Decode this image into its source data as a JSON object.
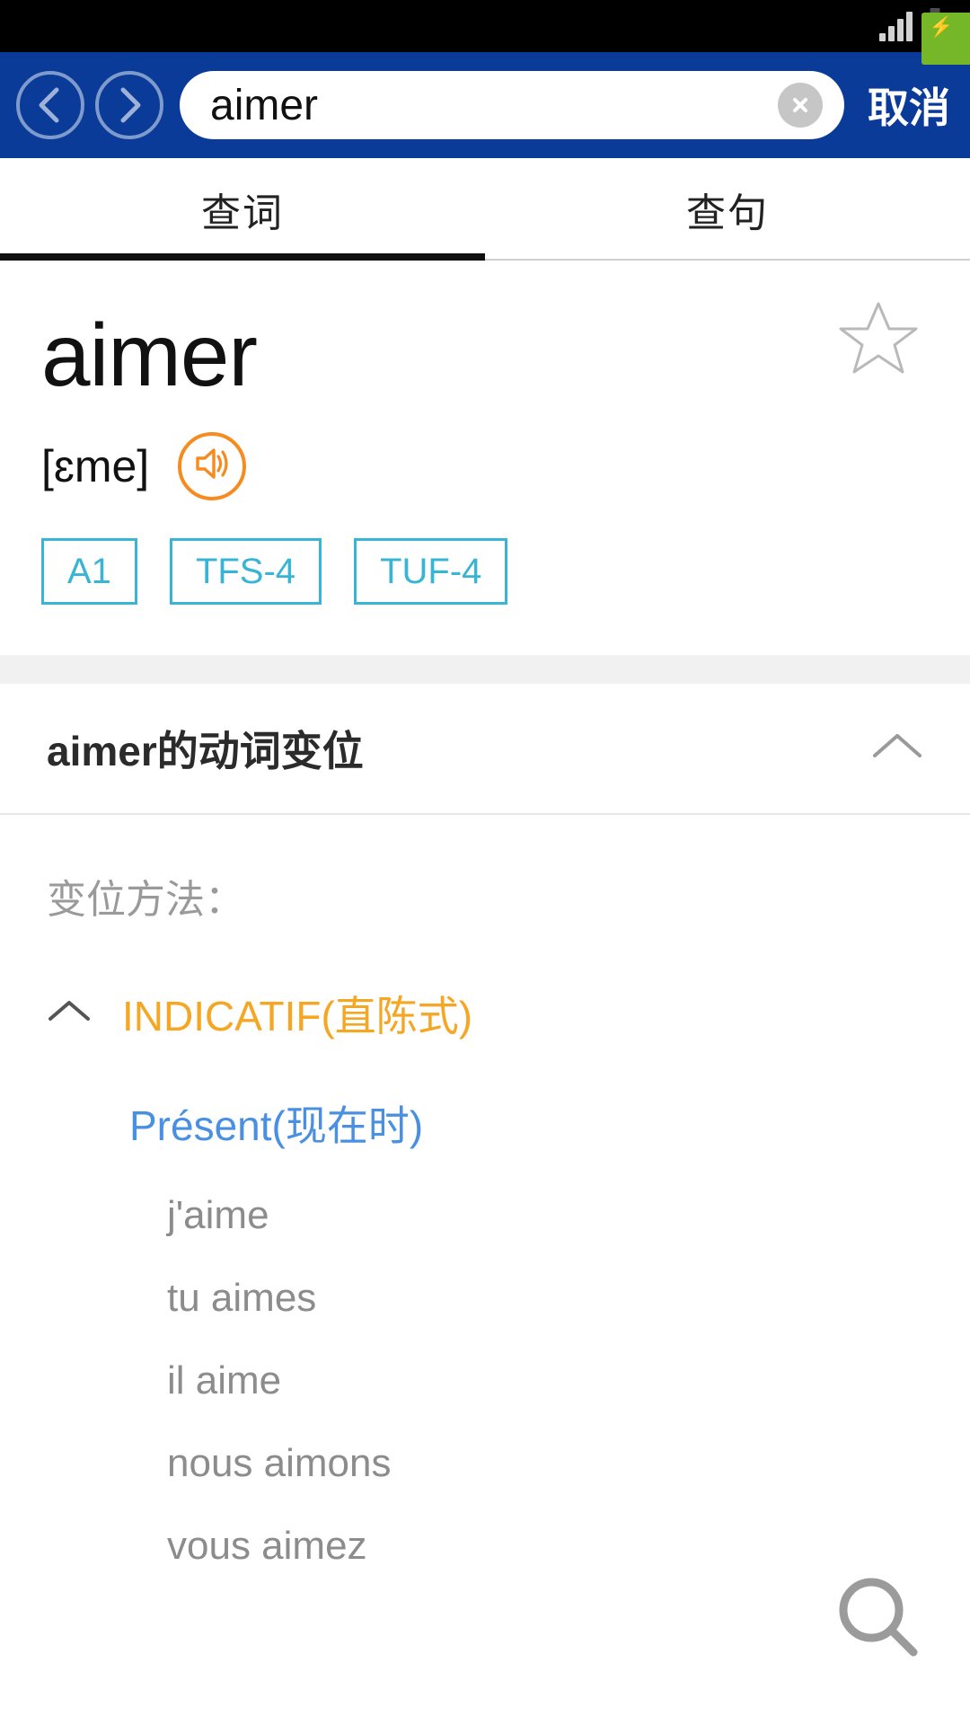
{
  "statusbar": {
    "signal_icon": "signal-bars-icon",
    "signal_bars": 4,
    "battery_icon": "battery-charging-icon",
    "battery_charging": true
  },
  "header": {
    "back_icon": "chevron-left-circle-icon",
    "forward_icon": "chevron-right-circle-icon",
    "search_value": "aimer",
    "search_placeholder": "aimer",
    "clear_icon": "close-circle-icon",
    "cancel_label": "取消",
    "background_color": "#0b3b99"
  },
  "tabs": {
    "items": [
      {
        "label": "查词",
        "active": true
      },
      {
        "label": "查句",
        "active": false
      }
    ],
    "active_index": 0,
    "indicator_color": "#111111"
  },
  "entry": {
    "word": "aimer",
    "phonetic": "[ɛme]",
    "speaker_icon": "speaker-volume-icon",
    "speaker_color": "#f68b1f",
    "favorite_icon": "star-outline-icon",
    "favorited": false,
    "tags": [
      "A1",
      "TFS-4",
      "TUF-4"
    ],
    "tag_color": "#38b5d4"
  },
  "conjugation": {
    "section_title": "aimer的动词变位",
    "section_collapse_icon": "chevron-up-icon",
    "section_expanded": true,
    "method_label": "变位方法：",
    "mood_collapse_icon": "chevron-up-icon",
    "mood_label": "INDICATIF(直陈式)",
    "mood_color": "#f5a623",
    "tense_label": "Présent(现在时)",
    "tense_color": "#4a90e2",
    "forms": [
      "j'aime",
      "tu aimes",
      "il aime",
      "nous aimons",
      "vous aimez"
    ]
  },
  "fab": {
    "icon": "search-magnifier-icon"
  }
}
